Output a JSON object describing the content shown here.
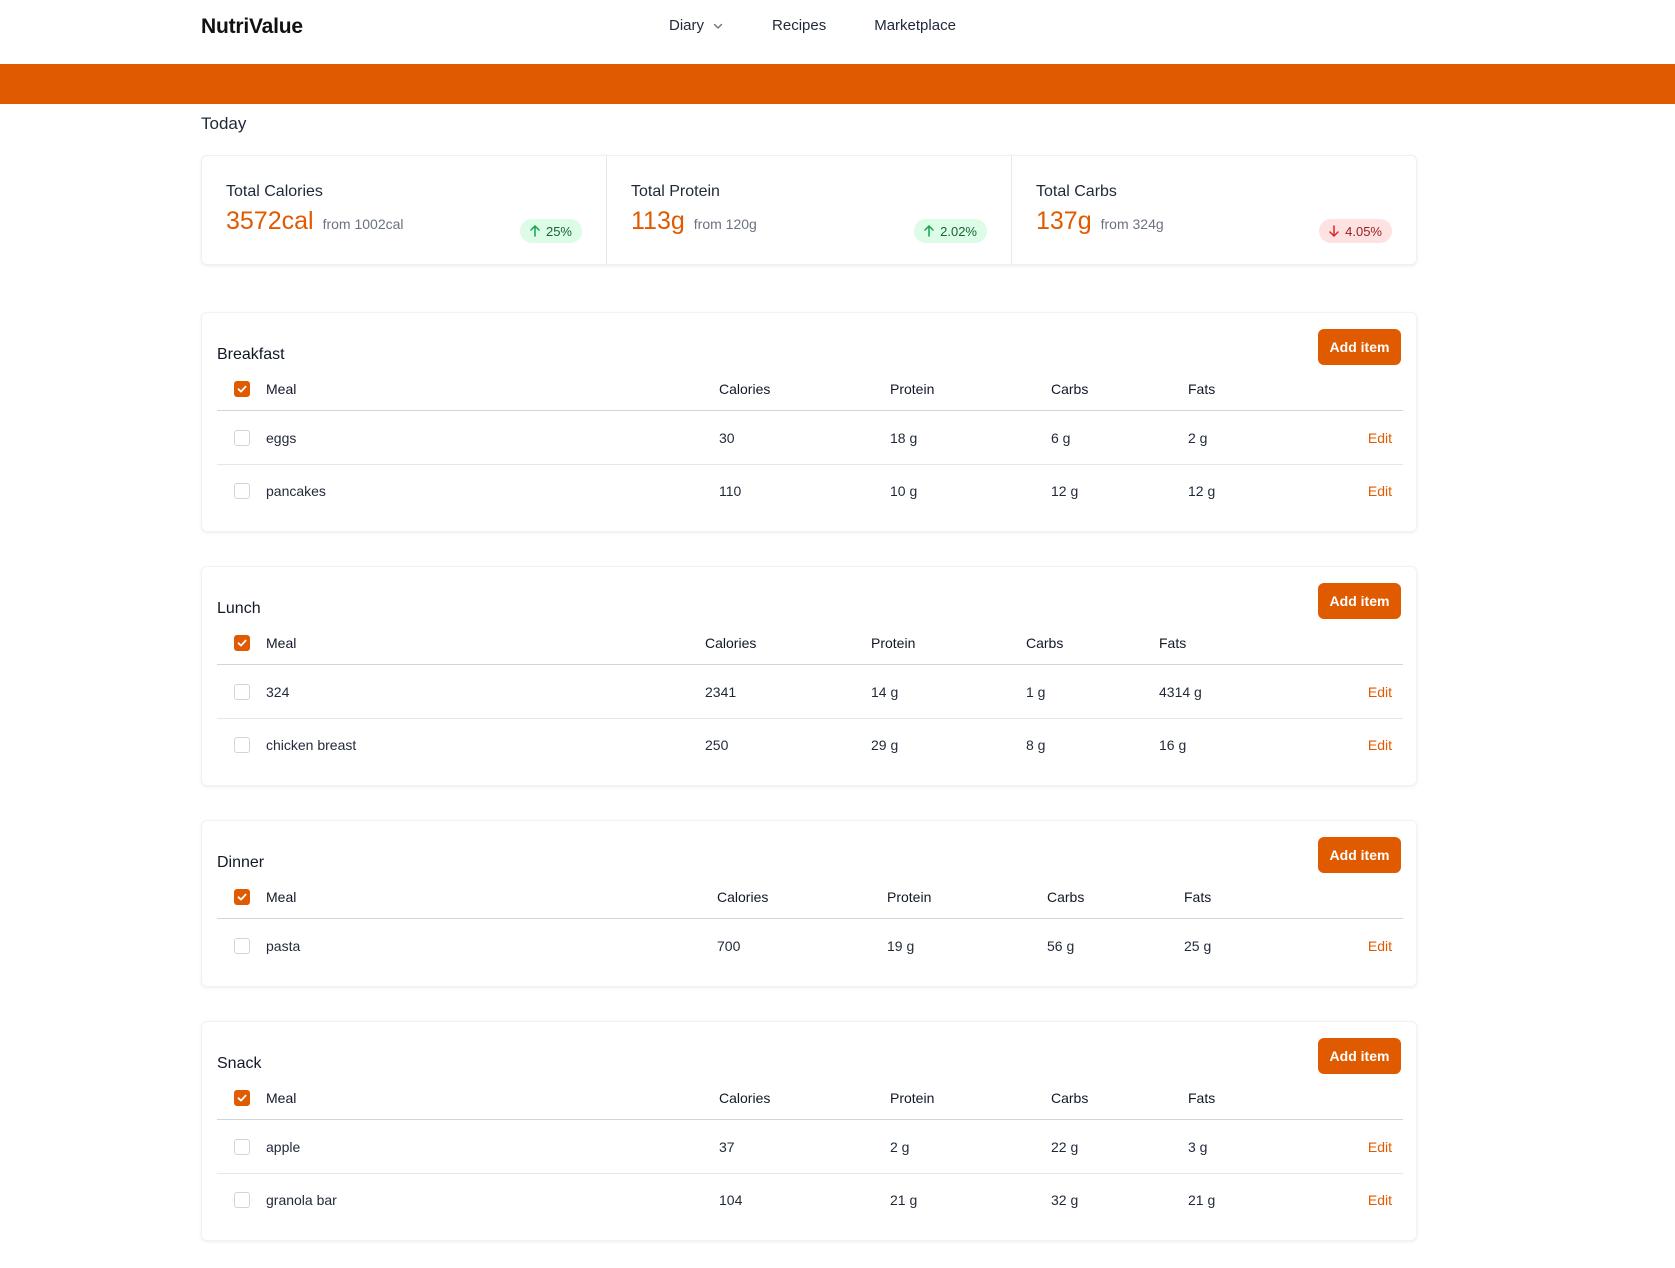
{
  "nav": {
    "brand": "NutriValue",
    "links": [
      {
        "label": "Diary",
        "has_dropdown": true
      },
      {
        "label": "Recipes"
      },
      {
        "label": "Marketplace"
      }
    ]
  },
  "page": {
    "title": "Today"
  },
  "stats": [
    {
      "label": "Total Calories",
      "value": "3572cal",
      "from": "from 1002cal",
      "change": "25%",
      "direction": "up"
    },
    {
      "label": "Total Protein",
      "value": "113g",
      "from": "from 120g",
      "change": "2.02%",
      "direction": "up"
    },
    {
      "label": "Total Carbs",
      "value": "137g",
      "from": "from 324g",
      "change": "4.05%",
      "direction": "down"
    }
  ],
  "colors": {
    "accent": "#e05a00",
    "up_bg": "#dcfce7",
    "up_text": "#166534",
    "down_bg": "#fee2e2",
    "down_text": "#991b1b"
  },
  "icons": {
    "checkbox_checked": "check-icon",
    "dropdown": "chevron-down-icon",
    "increase": "arrow-up-icon",
    "decrease": "arrow-down-icon"
  },
  "meals": [
    {
      "title": "Breakfast",
      "add_label": "Add item",
      "headers": [
        "Meal",
        "Calories",
        "Protein",
        "Carbs",
        "Fats"
      ],
      "rows": [
        {
          "name": "eggs",
          "calories": "30",
          "protein": "18 g",
          "carbs": "6 g",
          "fats": "2 g",
          "edit": "Edit"
        },
        {
          "name": "pancakes",
          "calories": "110",
          "protein": "10 g",
          "carbs": "12 g",
          "fats": "12 g",
          "edit": "Edit"
        }
      ]
    },
    {
      "title": "Lunch",
      "add_label": "Add item",
      "headers": [
        "Meal",
        "Calories",
        "Protein",
        "Carbs",
        "Fats"
      ],
      "rows": [
        {
          "name": "324",
          "calories": "2341",
          "protein": "14 g",
          "carbs": "1 g",
          "fats": "4314 g",
          "edit": "Edit"
        },
        {
          "name": "chicken breast",
          "calories": "250",
          "protein": "29 g",
          "carbs": "8 g",
          "fats": "16 g",
          "edit": "Edit"
        }
      ]
    },
    {
      "title": "Dinner",
      "add_label": "Add item",
      "headers": [
        "Meal",
        "Calories",
        "Protein",
        "Carbs",
        "Fats"
      ],
      "rows": [
        {
          "name": "pasta",
          "calories": "700",
          "protein": "19 g",
          "carbs": "56 g",
          "fats": "25 g",
          "edit": "Edit"
        }
      ]
    },
    {
      "title": "Snack",
      "add_label": "Add item",
      "headers": [
        "Meal",
        "Calories",
        "Protein",
        "Carbs",
        "Fats"
      ],
      "rows": [
        {
          "name": "apple",
          "calories": "37",
          "protein": "2 g",
          "carbs": "22 g",
          "fats": "3 g",
          "edit": "Edit"
        },
        {
          "name": "granola bar",
          "calories": "104",
          "protein": "21 g",
          "carbs": "32 g",
          "fats": "21 g",
          "edit": "Edit"
        }
      ]
    }
  ]
}
